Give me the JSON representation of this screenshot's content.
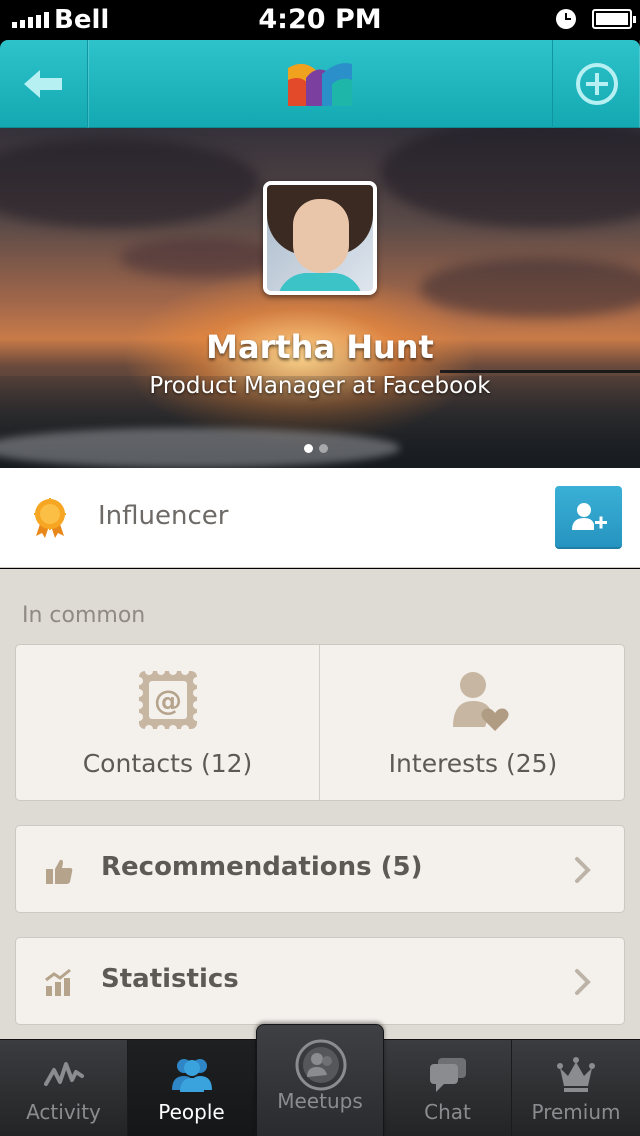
{
  "status_bar": {
    "carrier": "Bell",
    "time": "4:20 PM"
  },
  "navbar": {
    "back_icon": "back-arrow-icon",
    "logo": "app-logo",
    "add_icon": "plus-circle-icon"
  },
  "profile": {
    "name": "Martha Hunt",
    "title": "Product Manager at Facebook",
    "carousel_pages": 2,
    "carousel_active": 1
  },
  "badge": {
    "label": "Influencer",
    "icon": "medal-icon",
    "action_icon": "add-contact-icon"
  },
  "in_common": {
    "title": "In common",
    "items": [
      {
        "label": "Contacts (12)",
        "icon": "at-stamp-icon"
      },
      {
        "label": "Interests (25)",
        "icon": "person-heart-icon"
      }
    ]
  },
  "list": [
    {
      "label": "Recommendations (5)",
      "icon": "thumbs-up-icon"
    },
    {
      "label": "Statistics",
      "icon": "stats-chart-icon"
    }
  ],
  "tabs": [
    {
      "label": "Activity",
      "icon": "activity-wave-icon",
      "active": false
    },
    {
      "label": "People",
      "icon": "people-icon",
      "active": true
    },
    {
      "label": "Meetups",
      "icon": "meetups-icon",
      "active": false
    },
    {
      "label": "Chat",
      "icon": "chat-bubbles-icon",
      "active": false
    },
    {
      "label": "Premium",
      "icon": "crown-icon",
      "active": false
    }
  ],
  "colors": {
    "navbar": "#1fb6bf",
    "accent_blue": "#2a9fcb",
    "badge_orange": "#f39a1e",
    "content_bg": "#dedad4",
    "active_tab": "#3aa3de"
  }
}
